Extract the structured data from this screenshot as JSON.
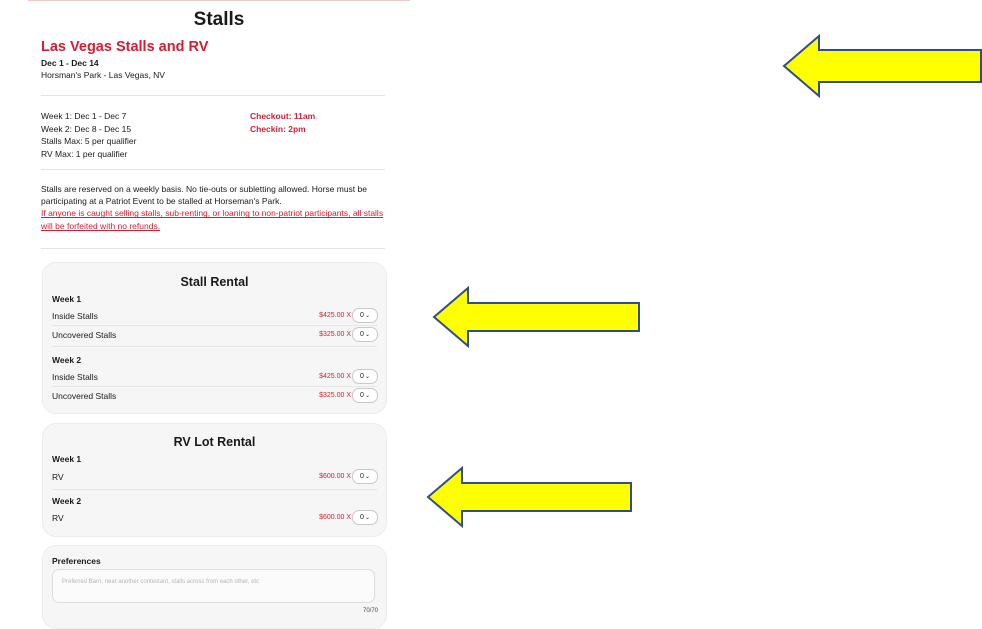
{
  "page": {
    "title": "Stalls"
  },
  "event": {
    "name": "Las Vegas Stalls and RV",
    "dates": "Dec 1 - Dec 14",
    "location": "Horsman's Park - Las Vegas, NV"
  },
  "info": {
    "left": [
      "Week 1: Dec 1 - Dec 7",
      "Week 2: Dec 8 - Dec 15",
      "Stalls Max: 5 per qualifier",
      "RV Max: 1 per qualifier"
    ],
    "right": [
      "Checkout: 11am",
      "Checkin: 2pm"
    ]
  },
  "rules": {
    "text": "Stalls are reserved on a weekly basis. No tie-outs or subletting allowed. Horse must be participating at a Patriot Event to be stalled at Horseman's Park.",
    "warning": "If anyone is caught selling stalls, sub-renting, or loaning to non-patriot participants, all stalls will be forfeited with no refunds."
  },
  "stall_rental": {
    "title": "Stall Rental",
    "weeks": [
      {
        "label": "Week 1",
        "items": [
          {
            "name": "Inside Stalls",
            "price": "$425.00 X",
            "qty": "0"
          },
          {
            "name": "Uncovered Stalls",
            "price": "$325.00 X",
            "qty": "0"
          }
        ]
      },
      {
        "label": "Week 2",
        "items": [
          {
            "name": "Inside Stalls",
            "price": "$425.00 X",
            "qty": "0"
          },
          {
            "name": "Uncovered Stalls",
            "price": "$325.00 X",
            "qty": "0"
          }
        ]
      }
    ]
  },
  "rv_rental": {
    "title": "RV Lot Rental",
    "weeks": [
      {
        "label": "Week 1",
        "items": [
          {
            "name": "RV",
            "price": "$600.00 X",
            "qty": "0"
          }
        ]
      },
      {
        "label": "Week 2",
        "items": [
          {
            "name": "RV",
            "price": "$600.00 X",
            "qty": "0"
          }
        ]
      }
    ]
  },
  "preferences": {
    "label": "Preferences",
    "placeholder": "Preferred Barn, near another contestant, stalls across from each other, etc",
    "counter": "70/70"
  },
  "colors": {
    "accent": "#d21f35",
    "arrow_fill": "#ffff00",
    "arrow_stroke": "#2f4e8c"
  },
  "chevron_glyph": "⌄"
}
